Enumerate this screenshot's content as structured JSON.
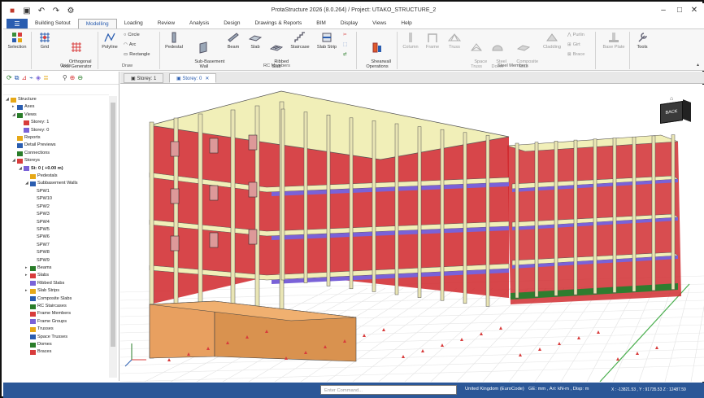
{
  "app": {
    "title": "ProtaStructure 2026 (8.0.264) / Project: UTAKO_STRUCTURE_2"
  },
  "menu_tabs": [
    "Building Setout",
    "Modelling",
    "Loading",
    "Review",
    "Analysis",
    "Design",
    "Drawings & Reports",
    "BIM",
    "Display",
    "Views",
    "Help"
  ],
  "active_tab": "Modelling",
  "ribbon": {
    "selection": "Selection",
    "grid": "Grid",
    "ortho_grid": "Orthogonal\nAxis Generator",
    "grids_group": "Grids",
    "polyline": "Polyline",
    "circle": "Circle",
    "arc": "Arc",
    "rectangle": "Rectangle",
    "draw_group": "Draw",
    "pedestal": "Pedestal",
    "subbasement_wall": "Sub-Basement\nWall",
    "beam": "Beam",
    "slab": "Slab",
    "ribbed_slab": "Ribbed\nSlab",
    "staircase": "Staircase",
    "slab_strip": "Slab Strip",
    "rc_group": "RC Members",
    "shearwall": "Shearwall\nOperations",
    "column": "Column",
    "frame": "Frame",
    "truss": "Truss",
    "space_truss": "Space\nTruss",
    "steel_dome": "Steel\nDome",
    "composite_slab": "Composite\nSlab",
    "cladding": "Cladding",
    "purlin": "Purlin",
    "girt": "Girt",
    "brace": "Brace",
    "steel_group": "Steel Members",
    "base_plate": "Base Plate",
    "tools": "Tools"
  },
  "view_tabs": [
    "Storey: 1",
    "Storey: 0"
  ],
  "active_view": "Storey: 0",
  "tree": [
    {
      "label": "Structure",
      "level": 0,
      "exp": "-"
    },
    {
      "label": "Axes",
      "level": 1,
      "exp": "+"
    },
    {
      "label": "Views",
      "level": 1,
      "exp": "-"
    },
    {
      "label": "Storey: 1",
      "level": 2,
      "exp": ""
    },
    {
      "label": "Storey: 0",
      "level": 2,
      "exp": ""
    },
    {
      "label": "Reports",
      "level": 1,
      "exp": ""
    },
    {
      "label": "Detail Previews",
      "level": 1,
      "exp": ""
    },
    {
      "label": "Connections",
      "level": 1,
      "exp": ""
    },
    {
      "label": "Storeys",
      "level": 1,
      "exp": "-"
    },
    {
      "label": "St: 0 ( +0.00 m)",
      "level": 2,
      "exp": "-",
      "bold": true
    },
    {
      "label": "Pedestals",
      "level": 3,
      "exp": ""
    },
    {
      "label": "Subbasement Walls",
      "level": 3,
      "exp": "-"
    },
    {
      "label": "SPW1",
      "level": 4,
      "exp": ""
    },
    {
      "label": "SPW10",
      "level": 4,
      "exp": ""
    },
    {
      "label": "SPW2",
      "level": 4,
      "exp": ""
    },
    {
      "label": "SPW3",
      "level": 4,
      "exp": ""
    },
    {
      "label": "SPW4",
      "level": 4,
      "exp": ""
    },
    {
      "label": "SPW5",
      "level": 4,
      "exp": ""
    },
    {
      "label": "SPW6",
      "level": 4,
      "exp": ""
    },
    {
      "label": "SPW7",
      "level": 4,
      "exp": ""
    },
    {
      "label": "SPW8",
      "level": 4,
      "exp": ""
    },
    {
      "label": "SPW9",
      "level": 4,
      "exp": ""
    },
    {
      "label": "Beams",
      "level": 3,
      "exp": "+"
    },
    {
      "label": "Slabs",
      "level": 3,
      "exp": "+"
    },
    {
      "label": "Ribbed Slabs",
      "level": 3,
      "exp": ""
    },
    {
      "label": "Slab Strips",
      "level": 3,
      "exp": "+"
    },
    {
      "label": "Composite Slabs",
      "level": 3,
      "exp": ""
    },
    {
      "label": "RC Staircases",
      "level": 3,
      "exp": ""
    },
    {
      "label": "Frame Members",
      "level": 3,
      "exp": ""
    },
    {
      "label": "Frame Groups",
      "level": 3,
      "exp": ""
    },
    {
      "label": "Trusses",
      "level": 3,
      "exp": ""
    },
    {
      "label": "Space Trusses",
      "level": 3,
      "exp": ""
    },
    {
      "label": "Domes",
      "level": 3,
      "exp": ""
    },
    {
      "label": "Braces",
      "level": 3,
      "exp": ""
    }
  ],
  "viewcube": "BACK",
  "status": {
    "command_placeholder": "Enter Command...",
    "code": "United Kingdom (EuroCode)",
    "units": "GE: mm , Ari: kN-m , Disp: m",
    "coords": "X : -13821.53 , Y : 91735.53  Z : 12487.59"
  },
  "colors": {
    "accent": "#2a5db0",
    "status": "#2b5797",
    "wall": "#d0262a",
    "slab": "#f1efb8",
    "beam_band": "#7a62d8"
  }
}
